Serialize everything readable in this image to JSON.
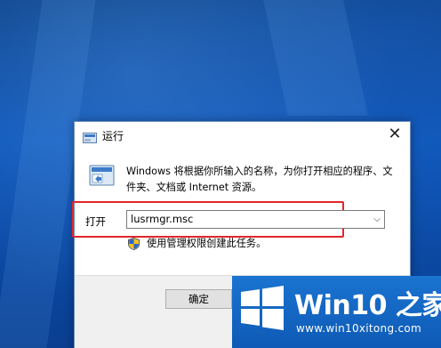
{
  "dialog": {
    "title": "运行",
    "close_glyph": "✕",
    "description": "Windows 将根据你所输入的名称，为你打开相应的程序、文件夹、文档或 Internet 资源。",
    "open_label": "打开",
    "open_value": "lusrmgr.msc",
    "dropdown_glyph": "⌵",
    "admin_note": "使用管理权限创建此任务。",
    "ok_label": "确定",
    "icons": {
      "title": "run-app-icon",
      "body": "run-app-icon",
      "admin": "uac-shield-icon",
      "close": "close-icon",
      "dropdown": "chevron-down-icon"
    }
  },
  "highlight": {
    "color": "#e1262a"
  },
  "watermark": {
    "title": "Win10 之家",
    "url": "www.win10xitong.com",
    "logo": "windows-logo-icon"
  }
}
